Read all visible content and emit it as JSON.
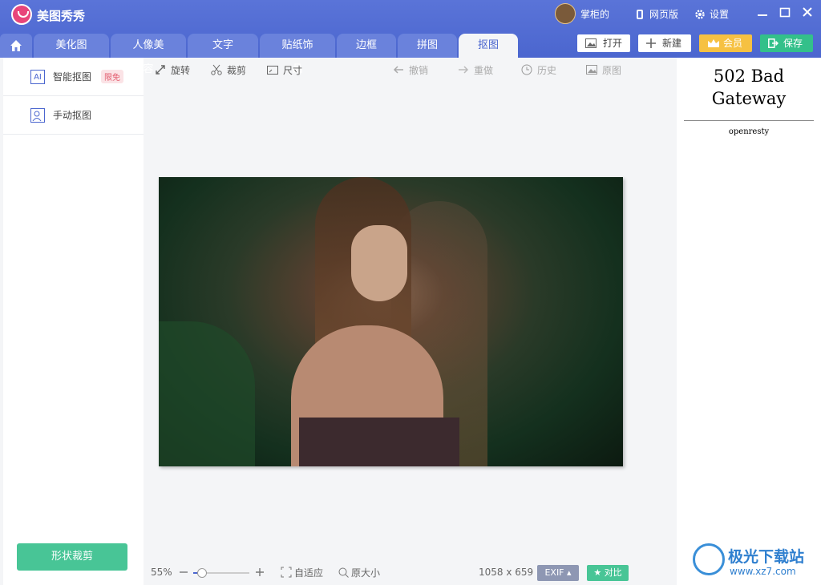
{
  "app": {
    "title": "美图秀秀"
  },
  "user": {
    "name": "掌柜的"
  },
  "topbar": {
    "web_version": "网页版",
    "settings": "设置"
  },
  "tabs": [
    {
      "label": "美化图片"
    },
    {
      "label": "人像美容"
    },
    {
      "label": "文字"
    },
    {
      "label": "贴纸饰品"
    },
    {
      "label": "边框"
    },
    {
      "label": "拼图"
    },
    {
      "label": "抠图",
      "active": true
    }
  ],
  "actions": {
    "open": "打开",
    "new": "新建",
    "vip": "会员",
    "save": "保存"
  },
  "sidebar": {
    "items": [
      {
        "icon_text": "AI",
        "label": "智能抠图",
        "badge": "限免"
      },
      {
        "icon_text": "",
        "label": "手动抠图"
      }
    ],
    "shape_crop": "形状裁剪"
  },
  "tools": {
    "rotate": "旋转",
    "crop": "裁剪",
    "size": "尺寸",
    "undo": "撤销",
    "redo": "重做",
    "history": "历史",
    "original": "原图"
  },
  "right_panel": {
    "error_title": "502 Bad Gateway",
    "error_server": "openresty",
    "watermark_text": "极光下载站",
    "watermark_url": "www.xz7.com"
  },
  "status": {
    "zoom": "55%",
    "zoom_fraction": 0.15,
    "fit": "自适应",
    "original_size": "原大小",
    "dimensions": "1058 x 659",
    "exif": "EXIF",
    "compare": "对比"
  },
  "colors": {
    "brand": "#4b66cf",
    "save": "#33c08a",
    "vip": "#f6c142",
    "accent_green": "#48c596"
  }
}
